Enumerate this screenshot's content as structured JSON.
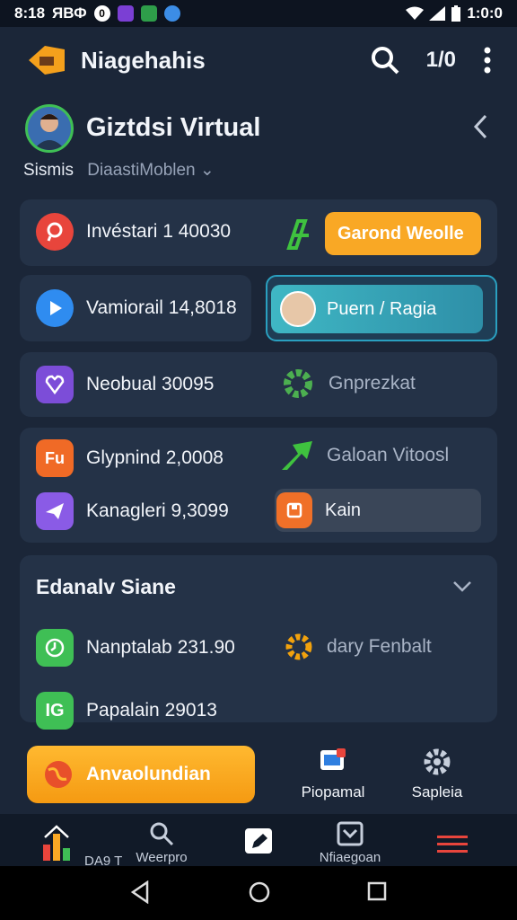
{
  "status_bar": {
    "time": "8:18",
    "carrier": "ЯВФ",
    "notif_badge": "0",
    "right_time": "1:0:0"
  },
  "header": {
    "title": "Niagehahis",
    "count": "1/0",
    "icons": [
      "search-icon",
      "more-vert-icon"
    ]
  },
  "profile": {
    "name": "Giztdsi Virtual",
    "label": "Sismis",
    "subtitle": "DiaastiMoblen"
  },
  "rows": [
    {
      "label": "Invéstari 1 40030",
      "icon": "location-pin-icon",
      "color": "#e8453c",
      "action_label": "Garond Weolle",
      "action_color": "#f9a825",
      "action_icon": "rollercoaster-icon"
    },
    {
      "label": "Vamiorail 14,8018",
      "icon": "play-icon",
      "color": "#2f8cf0",
      "action_label": "Puern / Ragia",
      "action_color": "#3bb0c0"
    },
    {
      "label": "Neobual 30095",
      "icon": "heart-badge-icon",
      "color": "#7c4dd8",
      "action_label": "Gnprezkat",
      "action_icon": "gear-icon",
      "action_icon_color": "#4caf50"
    },
    {
      "label": "Glypnind 2,0008",
      "icon": "fu-badge-icon",
      "icon_text": "Fu",
      "color": "#f06a26",
      "action_label": "Galoan Vitoosl",
      "action_icon": "arrow-icon",
      "action_icon_color": "#3fc23f"
    },
    {
      "label": "Kanagleri 9,3099",
      "icon": "paper-plane-icon",
      "color": "#8a5be6",
      "action_label": "Kain",
      "action_icon": "box-icon",
      "action_icon_color": "#f07028"
    }
  ],
  "section": {
    "title": "Edanalv Siane"
  },
  "section_rows": [
    {
      "label": "Nanptalab 231.90",
      "icon": "clock-icon",
      "color": "#3fbf55",
      "action_label": "dary Fenbalt",
      "action_icon_color": "#f2a20d"
    },
    {
      "label": "Papalain 29013",
      "icon": "ig-badge-icon",
      "icon_text": "IG",
      "color": "#3fbf55"
    }
  ],
  "cta": {
    "label": "Anvaolundian"
  },
  "quick_actions": [
    {
      "label": "Piopamal",
      "icon": "devices-icon"
    },
    {
      "label": "Sapleia",
      "icon": "gear-icon"
    }
  ],
  "bottom_nav": [
    {
      "label": "DA9 T",
      "icon": "chart-icon"
    },
    {
      "label": "Weerpro",
      "icon": "search-icon"
    },
    {
      "label": "",
      "icon": "pen-icon"
    },
    {
      "label": "Nfiaegoan",
      "icon": "inbox-icon"
    },
    {
      "label": "",
      "icon": "menu-icon"
    }
  ]
}
